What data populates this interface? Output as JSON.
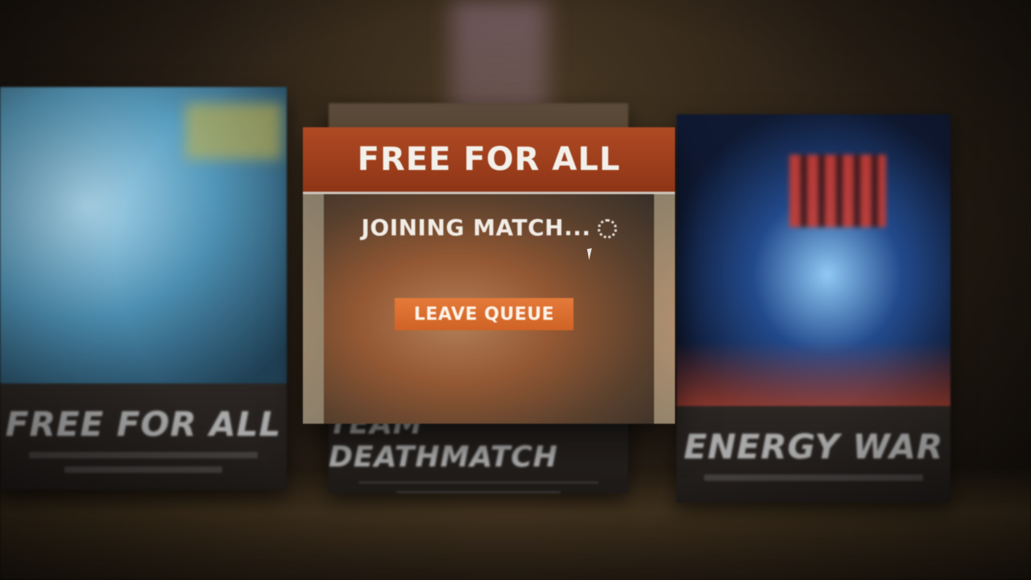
{
  "popup": {
    "title": "FREE FOR ALL",
    "status": "JOINING MATCH...",
    "leave_button": "LEAVE QUEUE",
    "accent_color": "#b04a24",
    "button_color": "#e57a3a"
  },
  "modes": [
    {
      "title": "FREE FOR ALL"
    },
    {
      "title": "TEAM DEATHMATCH"
    },
    {
      "title": "ENERGY WAR"
    }
  ],
  "icons": {
    "spinner": "loading-spinner-icon",
    "cursor": "mouse-pointer-icon"
  }
}
